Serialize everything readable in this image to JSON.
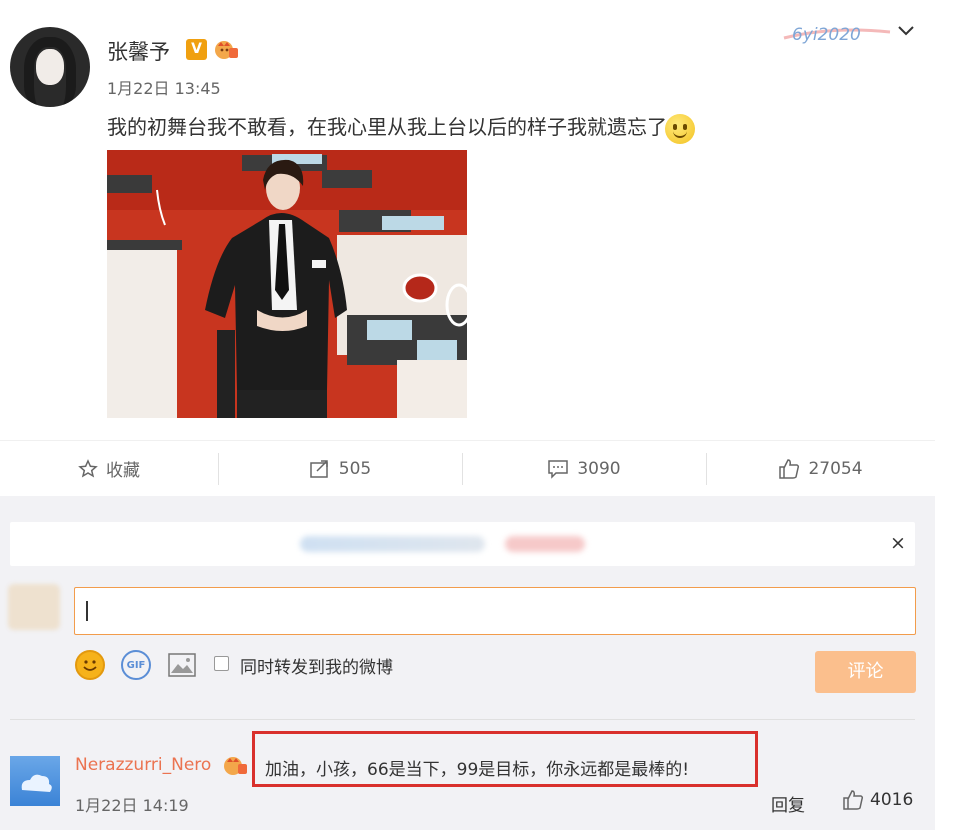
{
  "post": {
    "username": "张馨予",
    "vip_badge": "V",
    "timestamp": "1月22日 13:45",
    "watermark": "6yi2020",
    "text": "我的初舞台我不敢看，在我心里从我上台以后的样子我就遗忘了",
    "emoji": "smile-emoji"
  },
  "actions": {
    "favorite_label": "收藏",
    "repost_count": "505",
    "comment_count": "3090",
    "like_count": "27054"
  },
  "compose": {
    "checkbox_label": "同时转发到我的微博",
    "submit_label": "评论",
    "close_label": "×"
  },
  "comment": {
    "username": "Nerazzurri_Nero",
    "text": "加油，小孩，66是当下，99是目标，你永远都是最棒的!",
    "timestamp": "1月22日 14:19",
    "reply_label": "回复",
    "like_count": "4016"
  },
  "colors": {
    "accent_orange": "#f29c4b",
    "username_orange": "#eb7350",
    "highlight_red": "#d9302c"
  }
}
